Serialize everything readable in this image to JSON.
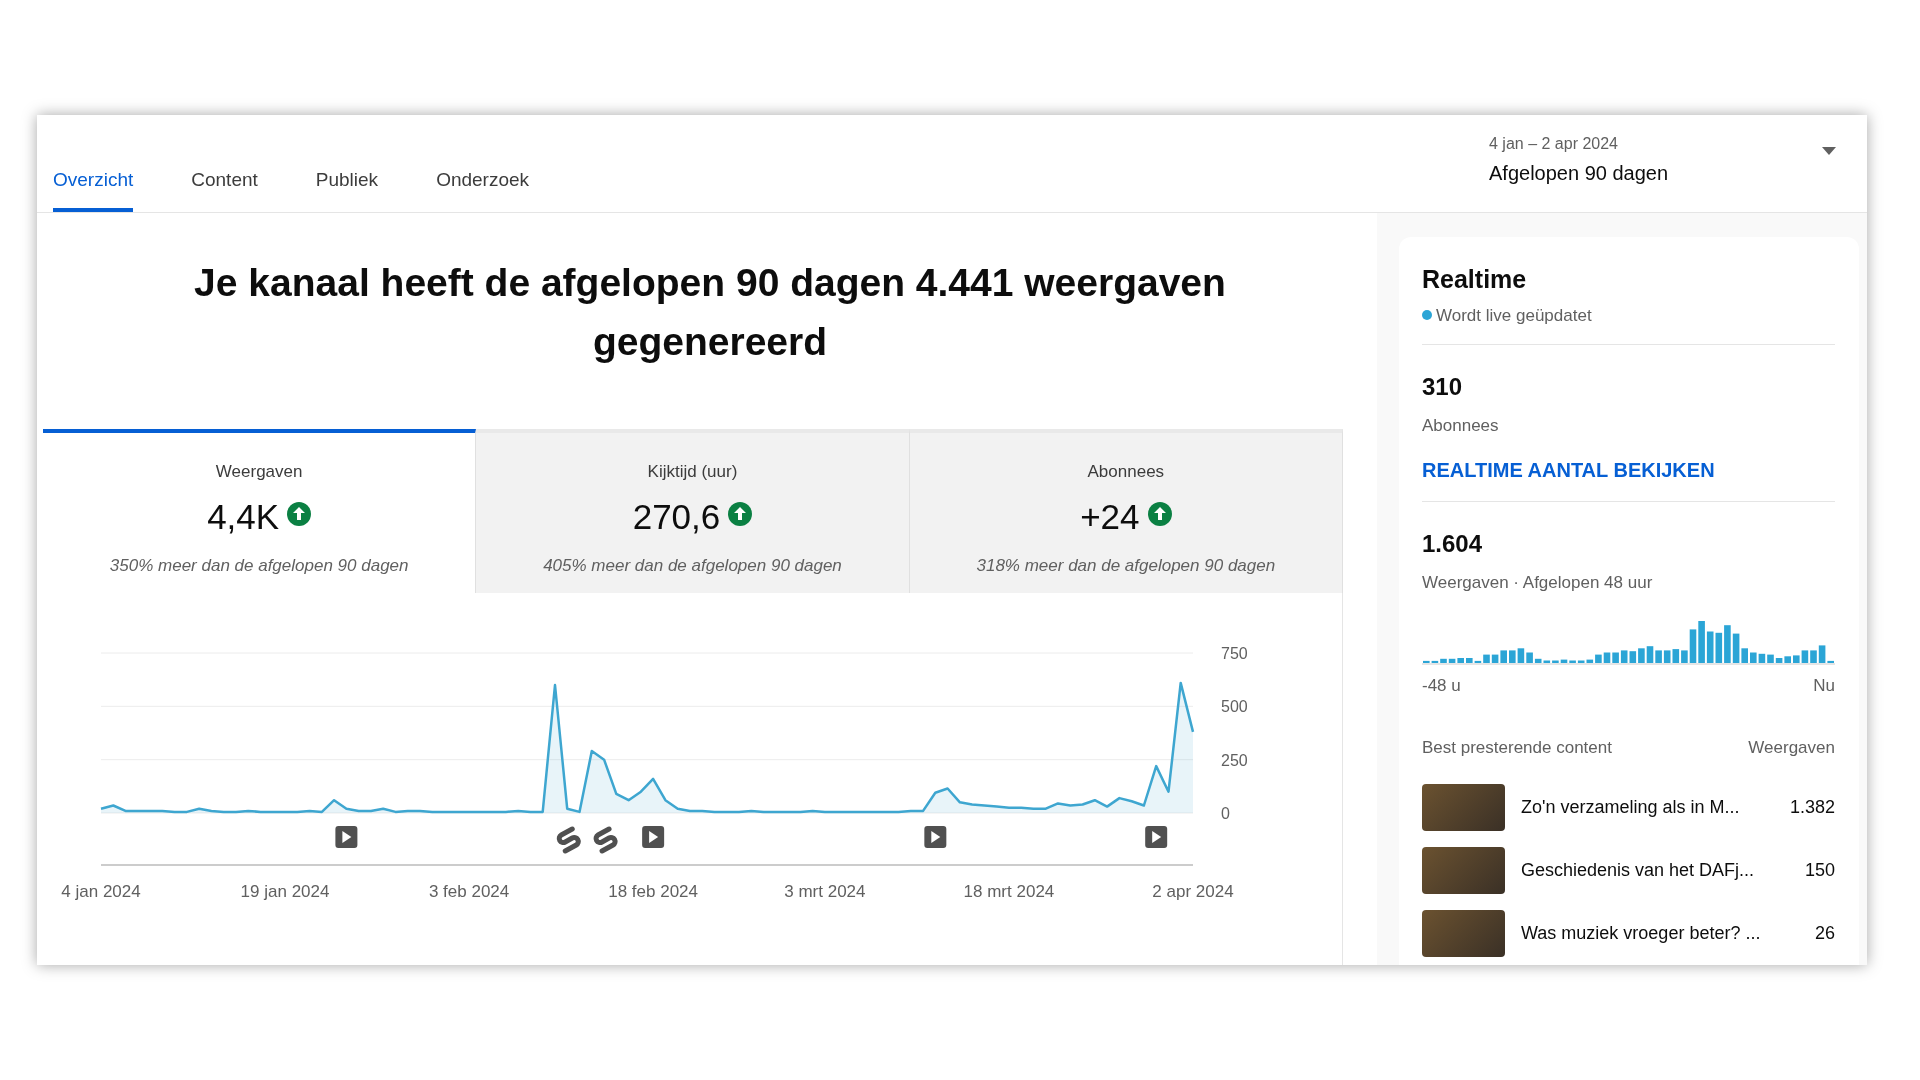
{
  "tabs": [
    {
      "label": "Overzicht",
      "selected": true
    },
    {
      "label": "Content",
      "selected": false
    },
    {
      "label": "Publiek",
      "selected": false
    },
    {
      "label": "Onderzoek",
      "selected": false
    }
  ],
  "date_range": {
    "dates": "4 jan – 2 apr 2024",
    "label": "Afgelopen 90 dagen"
  },
  "headline": "Je kanaal heeft de afgelopen 90 dagen 4.441 weergaven gegenereerd",
  "metrics": [
    {
      "label": "Weergaven",
      "value": "4,4K",
      "note": "350% meer dan de afgelopen 90 dagen",
      "selected": true
    },
    {
      "label": "Kijktijd (uur)",
      "value": "270,6",
      "note": "405% meer dan de afgelopen 90 dagen",
      "selected": false
    },
    {
      "label": "Abonnees",
      "value": "+24",
      "note": "318% meer dan de afgelopen 90 dagen",
      "selected": false
    }
  ],
  "chart_data": {
    "type": "area",
    "categories": [
      "4 jan 2024",
      null,
      null,
      null,
      null,
      null,
      null,
      null,
      null,
      null,
      null,
      null,
      null,
      null,
      null,
      "19 jan 2024",
      null,
      null,
      null,
      null,
      null,
      null,
      null,
      null,
      null,
      null,
      null,
      null,
      null,
      null,
      "3 feb 2024",
      null,
      null,
      null,
      null,
      null,
      null,
      null,
      null,
      null,
      null,
      null,
      null,
      null,
      null,
      "18 feb 2024",
      null,
      null,
      null,
      null,
      null,
      null,
      null,
      null,
      null,
      null,
      null,
      null,
      null,
      "3 mrt 2024",
      null,
      null,
      null,
      null,
      null,
      null,
      null,
      null,
      null,
      null,
      null,
      null,
      null,
      null,
      "18 mrt 2024",
      null,
      null,
      null,
      null,
      null,
      null,
      null,
      null,
      null,
      null,
      null,
      null,
      null,
      null,
      "2 apr 2024"
    ],
    "series": [
      {
        "color": "#3ea6d0",
        "values": [
          20,
          35,
          10,
          10,
          10,
          10,
          5,
          5,
          20,
          10,
          5,
          5,
          10,
          5,
          5,
          5,
          5,
          10,
          5,
          60,
          20,
          10,
          10,
          20,
          5,
          10,
          10,
          5,
          5,
          5,
          5,
          5,
          5,
          5,
          10,
          5,
          5,
          600,
          20,
          5,
          290,
          250,
          90,
          60,
          100,
          160,
          60,
          20,
          10,
          10,
          5,
          5,
          5,
          10,
          5,
          5,
          5,
          5,
          10,
          5,
          5,
          5,
          5,
          5,
          5,
          5,
          10,
          10,
          95,
          115,
          50,
          40,
          35,
          30,
          25,
          25,
          20,
          20,
          45,
          35,
          40,
          60,
          30,
          70,
          55,
          35,
          220,
          100,
          610,
          380
        ]
      }
    ],
    "yticks": [
      0,
      250,
      500,
      750
    ],
    "ylim": [
      0,
      750
    ]
  },
  "realtime": {
    "title": "Realtime",
    "live": "Wordt live geüpdatet",
    "subscribers": "310",
    "subscribers_label": "Abonnees",
    "link": "REALTIME AANTAL BEKIJKEN",
    "views": "1.604",
    "views_label": "Weergaven · Afgelopen 48 uur",
    "axis_start": "-48 u",
    "axis_end": "Nu",
    "top_header": "Best presterende content",
    "top_value_header": "Weergaven",
    "top_content": [
      {
        "title": "Zo'n verzameling als in M...",
        "views": "1.382"
      },
      {
        "title": "Geschiedenis van het DAFj...",
        "views": "150"
      },
      {
        "title": "Was muziek vroeger beter? ...",
        "views": "26"
      }
    ]
  }
}
